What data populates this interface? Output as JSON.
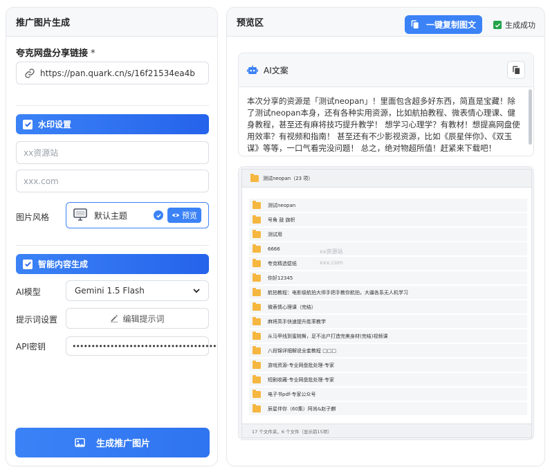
{
  "left_panel": {
    "title": "推广图片生成",
    "share_link": {
      "label": "夸克网盘分享链接",
      "required_mark": "*",
      "value": "https://pan.quark.cn/s/16f21534ea4b"
    },
    "watermark": {
      "section_label": "水印设置",
      "checked": true,
      "site_placeholder": "xx资源站",
      "domain_placeholder": "xxx.com"
    },
    "image_style": {
      "label": "图片风格",
      "theme_name": "默认主题",
      "preview_label": "预览"
    },
    "smart_content": {
      "section_label": "智能内容生成",
      "checked": true,
      "model_label": "AI模型",
      "model_value": "Gemini 1.5 Flash",
      "prompt_label": "提示词设置",
      "prompt_button": "编辑提示词",
      "api_key_label": "API密钥",
      "api_key_masked": "••••••••••••••••••••••••••••••••••••••"
    },
    "generate_button": "生成推广图片"
  },
  "right_panel": {
    "title": "预览区",
    "copy_all_button": "一键复制图文",
    "status_text": "生成成功",
    "ai_card": {
      "title": "AI文案",
      "text": "本次分享的资源是「测试neopan」！里面包含超多好东西，简直是宝藏！除了测试neopan本身，还有各种实用资源，比如航拍教程、微表情心理课、健身教程，甚至还有麻将技巧提升教学！ 想学习心理学？有教材！想提高网盘使用效率？有视频和指南！ 甚至还有不少影视资源，比如《辰星伴你》、《双玉谋》等等，一口气看完没问题！ 总之，绝对物超所值！赶紧来下载吧！"
    },
    "preview_image": {
      "header": "测试neopan（23 项）",
      "watermark_site": "xx资源站",
      "watermark_domain": "xxx.com",
      "files": [
        "测试neopan",
        "号角 鼓 旗帜",
        "测试用",
        "6666",
        "夸克精选壁纸",
        "你好12345",
        "航拍教程：电影级航拍大师手把手教你航拍，大疆各系无人机学习",
        "微表情心理课（完结）",
        "麻将高手快速提升胜率教学",
        "从马甲线到蜜桃臀，足不出户打造完美身材(完结)视频课",
        "八段锦详细解说全套教程 □□□",
        "游戏资源-专业网盘批处理-专家",
        "短剧收藏-专业网盘批处理-专家",
        "电子书pdf-专家公众号",
        "辰星伴你（60集）阿尚&赵子麒"
      ],
      "footer": "17 个文件夹，6 个文件（显示前15项）"
    }
  },
  "colors": {
    "accent": "#3b82f6",
    "success": "#22a34a",
    "folder": "#f5b740"
  }
}
